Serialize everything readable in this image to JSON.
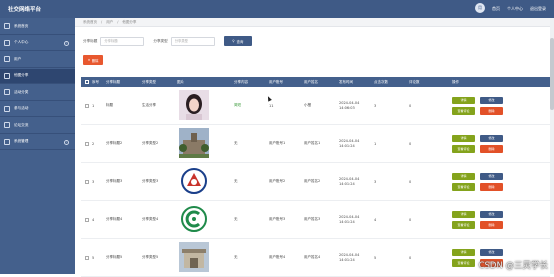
{
  "app": {
    "title": "社交网络平台"
  },
  "topbar": {
    "avatar_text": "用",
    "home": "首页",
    "profile": "个人中心",
    "logout": "退出登录"
  },
  "sidebar": {
    "items": [
      {
        "label": "系统首页",
        "icon": "home-icon",
        "expandable": false
      },
      {
        "label": "个人中心",
        "icon": "person-icon",
        "expandable": true
      },
      {
        "label": "用户",
        "icon": "users-icon",
        "expandable": false
      },
      {
        "label": "他图分享",
        "icon": "share-icon",
        "expandable": false
      },
      {
        "label": "活动分类",
        "icon": "category-icon",
        "expandable": false
      },
      {
        "label": "参与活动",
        "icon": "activity-icon",
        "expandable": false
      },
      {
        "label": "论坛交流",
        "icon": "forum-icon",
        "expandable": false
      },
      {
        "label": "系统管理",
        "icon": "settings-icon",
        "expandable": true
      }
    ]
  },
  "breadcrumb": [
    "系统首页",
    "用户",
    "他图分享"
  ],
  "search": {
    "title_label": "分享标题",
    "title_placeholder": "分享标题",
    "type_label": "分享类型",
    "type_placeholder": "分享类型",
    "button": "查询"
  },
  "delete_button": "删除",
  "table": {
    "headers": [
      "序号",
      "分享标题",
      "分享类型",
      "图片",
      "分享内容",
      "用户账号",
      "用户姓名",
      "发布时间",
      "点击次数",
      "评论数",
      "操作"
    ],
    "ops": {
      "detail": "详情",
      "edit": "修改",
      "review": "查看评论",
      "delete": "删除"
    },
    "rows": [
      {
        "idx": "1",
        "title": "标题",
        "type": "生活分享",
        "content": "简短",
        "account": "11",
        "name": "小橙",
        "time": "2024-04-04 14:06:03",
        "clicks": "3",
        "comments": "0",
        "thumb": "thumb-1"
      },
      {
        "idx": "2",
        "title": "分享标题2",
        "type": "分享类型2",
        "content": "无",
        "account": "用户账号1",
        "name": "用户姓名1",
        "time": "2024-04-04 14:01:24",
        "clicks": "1",
        "comments": "0",
        "thumb": "thumb-2"
      },
      {
        "idx": "3",
        "title": "分享标题3",
        "type": "分享类型3",
        "content": "无",
        "account": "用户账号2",
        "name": "用户姓名2",
        "time": "2024-04-04 14:01:24",
        "clicks": "3",
        "comments": "0",
        "thumb": "thumb-3"
      },
      {
        "idx": "4",
        "title": "分享标题4",
        "type": "分享类型4",
        "content": "无",
        "account": "用户账号3",
        "name": "用户姓名3",
        "time": "2024-04-04 14:01:24",
        "clicks": "4",
        "comments": "0",
        "thumb": "thumb-4"
      },
      {
        "idx": "5",
        "title": "分享标题5",
        "type": "分享类型5",
        "content": "无",
        "account": "用户账号4",
        "name": "用户姓名4",
        "time": "2024-04-04 14:01:24",
        "clicks": "5",
        "comments": "0",
        "thumb": "thumb-5"
      }
    ]
  },
  "watermark": "CSDN @三灵学长",
  "colors": {
    "header": "#3f5a86",
    "sidebar": "#44608c",
    "detail": "#84a31c",
    "edit": "#3f5a86",
    "delete": "#e25128"
  }
}
